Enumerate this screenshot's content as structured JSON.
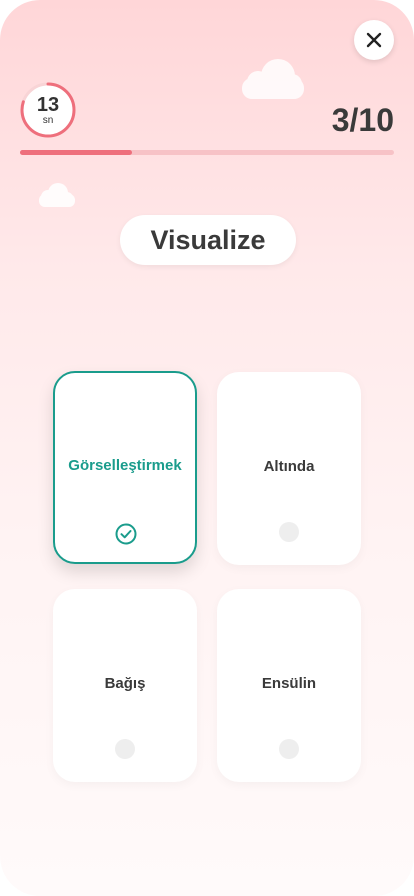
{
  "timer": {
    "value": "13",
    "unit": "sn",
    "remaining_fraction": 0.8
  },
  "progress": {
    "counter": "3/10",
    "current": 3,
    "total": 10
  },
  "question": {
    "word": "Visualize"
  },
  "options": [
    {
      "label": "Görselleştirmek",
      "selected": true
    },
    {
      "label": "Altında",
      "selected": false
    },
    {
      "label": "Bağış",
      "selected": false
    },
    {
      "label": "Ensülin",
      "selected": false
    }
  ],
  "colors": {
    "accent_red": "#ee6f7c",
    "selected_teal": "#1a9c8c",
    "text_dark": "#3a3a3a"
  },
  "icons": {
    "close": "close-icon",
    "check": "check-circle-icon",
    "cloud": "cloud-icon"
  }
}
